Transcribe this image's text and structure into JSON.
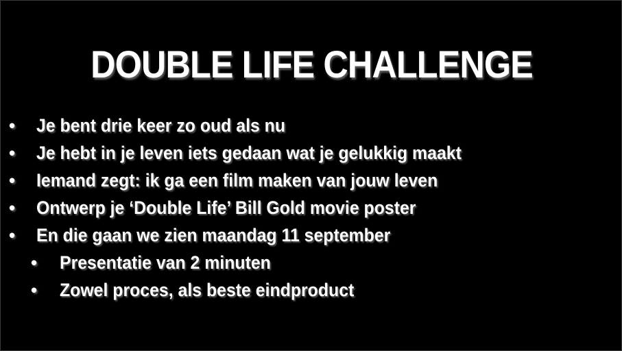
{
  "slide": {
    "title": "DOUBLE LIFE CHALLENGE",
    "bullet_glyph": "•",
    "bullets": [
      {
        "text": "Je bent drie keer zo oud als nu"
      },
      {
        "text": "Je hebt in je leven iets gedaan wat je gelukkig maakt"
      },
      {
        "text": "Iemand zegt: ik ga een film maken van jouw leven"
      },
      {
        "text": "Ontwerp je ‘Double Life’ Bill Gold movie poster"
      },
      {
        "text": "En die gaan we zien maandag 11 september"
      }
    ],
    "sub_bullets": [
      {
        "text": "Presentatie van 2 minuten"
      },
      {
        "text": "Zowel proces, als beste eindproduct"
      }
    ],
    "colors": {
      "background": "#000000",
      "text": "#ffffff",
      "shadow": "#5a5a5a"
    }
  }
}
